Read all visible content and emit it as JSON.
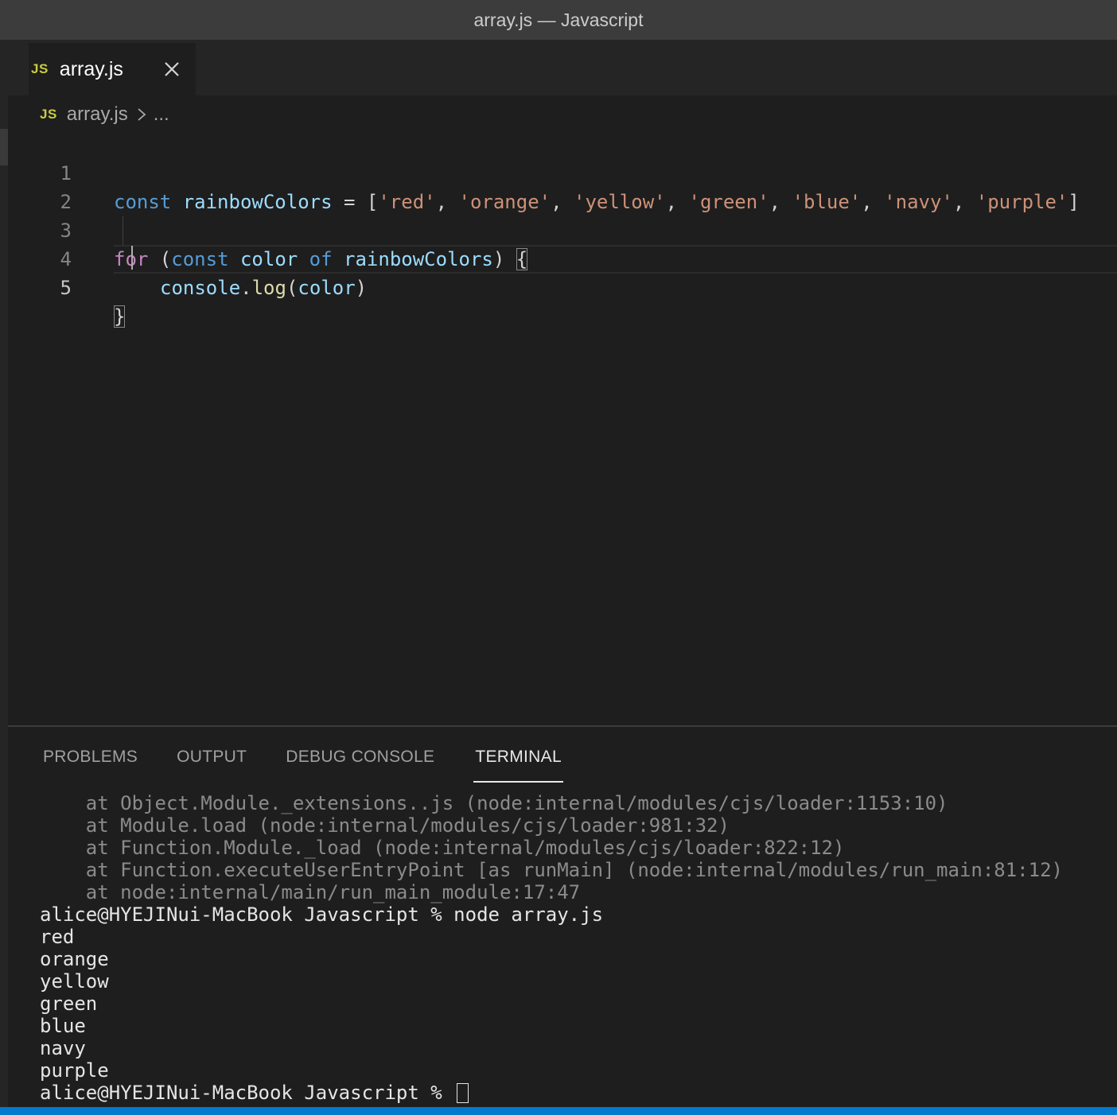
{
  "window": {
    "title": "array.js — Javascript"
  },
  "tab": {
    "badge": "JS",
    "label": "array.js"
  },
  "breadcrumb": {
    "badge": "JS",
    "file": "array.js",
    "rest": "..."
  },
  "editor": {
    "line_numbers": [
      "1",
      "2",
      "3",
      "4",
      "5"
    ],
    "line1": {
      "kw": "const",
      "name": "rainbowColors",
      "op": " = [",
      "s1": "'red'",
      "s2": "'orange'",
      "s3": "'yellow'",
      "s4": "'green'",
      "s5": "'blue'",
      "s6": "'navy'",
      "s7": "'purple'",
      "sep": ", ",
      "close": "]"
    },
    "line3": {
      "for": "for",
      "paren": " (",
      "kw": "const",
      "var": "color",
      "of": "of",
      "arr": "rainbowColors",
      "close": ")",
      "brace": "{"
    },
    "line4": {
      "obj": "console",
      "dot": ".",
      "fn": "log",
      "open": "(",
      "arg": "color",
      "close": ")"
    },
    "line5": {
      "brace": "}"
    }
  },
  "panel": {
    "tabs": [
      "PROBLEMS",
      "OUTPUT",
      "DEBUG CONSOLE",
      "TERMINAL"
    ],
    "active_tab": "TERMINAL"
  },
  "terminal": {
    "stack": [
      "    at Object.Module._extensions..js (node:internal/modules/cjs/loader:1153:10)",
      "    at Module.load (node:internal/modules/cjs/loader:981:32)",
      "    at Function.Module._load (node:internal/modules/cjs/loader:822:12)",
      "    at Function.executeUserEntryPoint [as runMain] (node:internal/modules/run_main:81:12)",
      "    at node:internal/main/run_main_module:17:47"
    ],
    "command_line": "alice@HYEJINui-MacBook Javascript % node array.js",
    "output": [
      "red",
      "orange",
      "yellow",
      "green",
      "blue",
      "navy",
      "purple"
    ],
    "prompt": "alice@HYEJINui-MacBook Javascript % "
  },
  "colors": {
    "accent": "#007acc",
    "background": "#1e1e1e",
    "keyword": "#569cd6",
    "string": "#ce9178",
    "control": "#c586c0"
  }
}
